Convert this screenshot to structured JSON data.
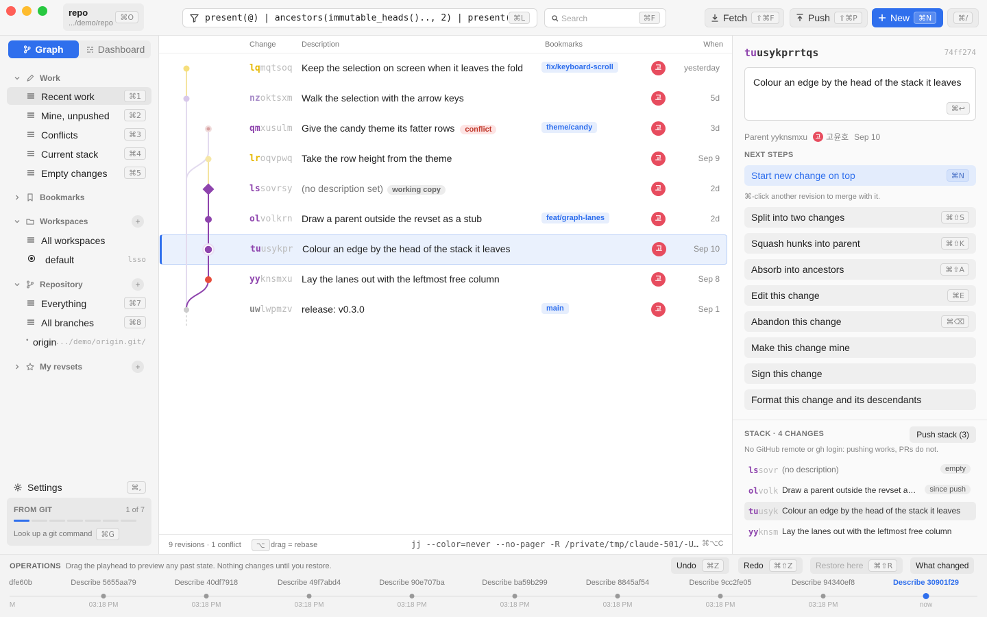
{
  "window": {
    "title": "repo",
    "path": ".../demo/repo",
    "open_shortcut": "⌘O"
  },
  "revset": {
    "query": "present(@) | ancestors(immutable_heads().., 2) | present(trunk())",
    "shortcut": "⌘L"
  },
  "search": {
    "placeholder": "Search",
    "shortcut": "⌘F"
  },
  "toolbar": {
    "fetch_label": "Fetch",
    "fetch_shortcut": "⇧⌘F",
    "push_label": "Push",
    "push_shortcut": "⇧⌘P",
    "new_label": "New",
    "new_shortcut": "⌘N",
    "help_shortcut": "⌘/"
  },
  "sidebar": {
    "tabs": {
      "graph": "Graph",
      "dashboard": "Dashboard"
    },
    "work": {
      "title": "Work",
      "items": [
        {
          "label": "Recent work",
          "shortcut": "⌘1"
        },
        {
          "label": "Mine, unpushed",
          "shortcut": "⌘2"
        },
        {
          "label": "Conflicts",
          "shortcut": "⌘3"
        },
        {
          "label": "Current stack",
          "shortcut": "⌘4"
        },
        {
          "label": "Empty changes",
          "shortcut": "⌘5"
        }
      ]
    },
    "bookmarks": {
      "title": "Bookmarks"
    },
    "workspaces": {
      "title": "Workspaces",
      "add": "+",
      "items": [
        {
          "label": "All workspaces"
        },
        {
          "label": "default",
          "aux": "lsso"
        }
      ]
    },
    "repository": {
      "title": "Repository",
      "add": "+",
      "items": [
        {
          "label": "Everything",
          "shortcut": "⌘7"
        },
        {
          "label": "All branches",
          "shortcut": "⌘8"
        },
        {
          "label": "origin",
          "aux": ".../demo/origin.git/"
        }
      ]
    },
    "revsets": {
      "title": "My revsets",
      "add": "+"
    },
    "settings": {
      "label": "Settings",
      "shortcut": "⌘,"
    },
    "from_git": {
      "title": "FROM GIT",
      "count": "1 of 7",
      "hint": "Look up a git command",
      "shortcut": "⌘G"
    }
  },
  "log": {
    "headers": {
      "change": "Change",
      "description": "Description",
      "bookmarks": "Bookmarks",
      "when": "When"
    },
    "rows": [
      {
        "prefix": "lq",
        "rest": "mqtsoq",
        "color": "#e6b800",
        "desc": "Keep the selection on screen when it leaves the fold",
        "bookmark": "fix/keyboard-scroll",
        "avatar": "고",
        "when": "yesterday"
      },
      {
        "prefix": "nz",
        "rest": "oktsxm",
        "color": "#a78bc8",
        "desc": "Walk the selection with the arrow keys",
        "bookmark": "",
        "avatar": "고",
        "when": "5d"
      },
      {
        "prefix": "qm",
        "rest": "xusulm",
        "color": "#8e44ad",
        "desc": "Give the candy theme its fatter rows",
        "badge": "conflict",
        "bookmark": "theme/candy",
        "avatar": "고",
        "when": "3d"
      },
      {
        "prefix": "lr",
        "rest": "oqvpwq",
        "color": "#e6b800",
        "desc": "Take the row height from the theme",
        "bookmark": "",
        "avatar": "고",
        "when": "Sep 9"
      },
      {
        "prefix": "ls",
        "rest": "sovrsy",
        "color": "#8e44ad",
        "desc": "(no description set)",
        "badge": "working copy",
        "bookmark": "",
        "avatar": "고",
        "when": "2d"
      },
      {
        "prefix": "ol",
        "rest": "volkrn",
        "color": "#8e44ad",
        "desc": "Draw a parent outside the revset as a stub",
        "bookmark": "feat/graph-lanes",
        "avatar": "고",
        "when": "2d"
      },
      {
        "prefix": "tu",
        "rest": "usykpr",
        "color": "#8e44ad",
        "desc": "Colour an edge by the head of the stack it leaves",
        "bookmark": "",
        "avatar": "고",
        "when": "Sep 10"
      },
      {
        "prefix": "yy",
        "rest": "knsmxu",
        "color": "#8e44ad",
        "desc": "Lay the lanes out with the leftmost free column",
        "bookmark": "",
        "avatar": "고",
        "when": "Sep 8"
      },
      {
        "prefix": "uw",
        "rest": "lwpmzv",
        "color": "#888888",
        "desc": "release: v0.3.0",
        "bookmark": "main",
        "avatar": "고",
        "when": "Sep 1"
      }
    ],
    "status": {
      "summary": "9 revisions · 1 conflict",
      "drag_key": "⌥",
      "drag_hint": "drag = rebase",
      "command": "jj --color=never --no-pager -R /private/tmp/claude-501/-U…",
      "copy_shortcut": "⌘⌥C"
    }
  },
  "detail": {
    "change_prefix": "tu",
    "change_rest": "usykprrtqs",
    "commit_hash": "74ff274",
    "description": "Colour an edge by the head of the stack it leaves",
    "save_shortcut": "⌘↩",
    "parent_label": "Parent yyknsmxu",
    "author_avatar": "고",
    "author": "고윤호",
    "date": "Sep 10",
    "next_steps_title": "NEXT STEPS",
    "primary_action": {
      "label": "Start new change on top",
      "shortcut": "⌘N"
    },
    "merge_hint": "⌘-click another revision to merge with it.",
    "actions": [
      {
        "label": "Split into two changes",
        "shortcut": "⌘⇧S"
      },
      {
        "label": "Squash hunks into parent",
        "shortcut": "⌘⇧K"
      },
      {
        "label": "Absorb into ancestors",
        "shortcut": "⌘⇧A"
      },
      {
        "label": "Edit this change",
        "shortcut": "⌘E"
      },
      {
        "label": "Abandon this change",
        "shortcut": "⌘⌫"
      },
      {
        "label": "Make this change mine",
        "shortcut": ""
      },
      {
        "label": "Sign this change",
        "shortcut": ""
      },
      {
        "label": "Format this change and its descendants",
        "shortcut": ""
      }
    ],
    "stack": {
      "title": "STACK · 4 CHANGES",
      "push_label": "Push stack (3)",
      "note": "No GitHub remote or gh login: pushing works, PRs do not.",
      "items": [
        {
          "prefix": "ls",
          "rest": "sovr",
          "desc": "(no description)",
          "badge": "empty"
        },
        {
          "prefix": "ol",
          "rest": "volk",
          "desc": "Draw a parent outside the revset a…",
          "badge": "since push"
        },
        {
          "prefix": "tu",
          "rest": "usyk",
          "desc": "Colour an edge by the head of the stack it leaves",
          "badge": ""
        },
        {
          "prefix": "yy",
          "rest": "knsm",
          "desc": "Lay the lanes out with the leftmost free column",
          "badge": ""
        }
      ]
    }
  },
  "operations": {
    "title": "OPERATIONS",
    "hint": "Drag the playhead to preview any past state. Nothing changes until you restore.",
    "undo": "Undo",
    "undo_shortcut": "⌘Z",
    "redo": "Redo",
    "redo_shortcut": "⌘⇧Z",
    "restore": "Restore here",
    "restore_shortcut": "⌘⇧R",
    "what_changed": "What changed",
    "timeline": [
      {
        "label": "dfe60b",
        "time": "M"
      },
      {
        "label": "Describe 5655aa79",
        "time": "03:18 PM"
      },
      {
        "label": "Describe 40df7918",
        "time": "03:18 PM"
      },
      {
        "label": "Describe 49f7abd4",
        "time": "03:18 PM"
      },
      {
        "label": "Describe 90e707ba",
        "time": "03:18 PM"
      },
      {
        "label": "Describe ba59b299",
        "time": "03:18 PM"
      },
      {
        "label": "Describe 8845af54",
        "time": "03:18 PM"
      },
      {
        "label": "Describe 9cc2fe05",
        "time": "03:18 PM"
      },
      {
        "label": "Describe 94340ef8",
        "time": "03:18 PM"
      },
      {
        "label": "Describe 30901f29",
        "time": "now"
      }
    ]
  },
  "colors": {
    "accent": "#2f6fed",
    "change_prefix": "#8e44ad",
    "conflict": "#c0392b",
    "avatar": "#e74c5e"
  }
}
